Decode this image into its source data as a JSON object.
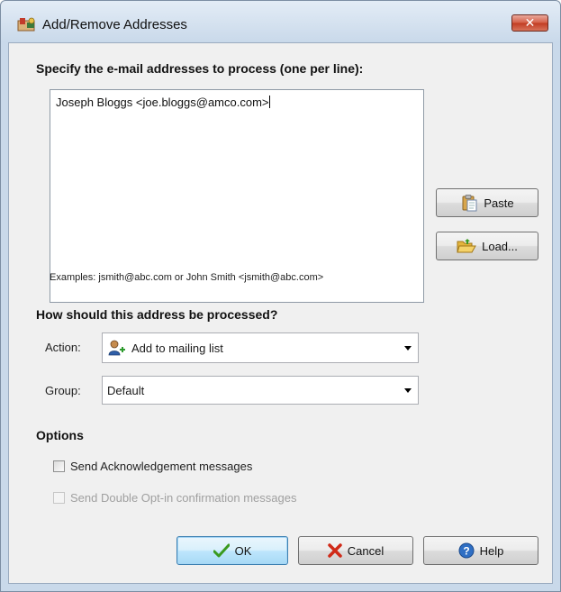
{
  "window": {
    "title": "Add/Remove Addresses",
    "close_glyph": "✕"
  },
  "addresses": {
    "heading": "Specify the e-mail addresses to process (one per line):",
    "value": "Joseph Bloggs <joe.bloggs@amco.com>",
    "examples": "Examples: jsmith@abc.com or John Smith <jsmith@abc.com>",
    "paste_label": "Paste",
    "load_label": "Load..."
  },
  "processing": {
    "heading": "How should this address be processed?",
    "action_label": "Action:",
    "action_value": "Add to mailing list",
    "action_icon": "add-user-icon",
    "group_label": "Group:",
    "group_value": "Default"
  },
  "options": {
    "heading": "Options",
    "acknowledgement_label": "Send Acknowledgement messages",
    "acknowledgement_checked": false,
    "double_optin_label": "Send Double Opt-in confirmation messages",
    "double_optin_checked": false,
    "double_optin_enabled": false
  },
  "footer": {
    "ok_label": "OK",
    "cancel_label": "Cancel",
    "help_label": "Help"
  },
  "colors": {
    "ok_check": "#3a9a1f",
    "cancel_x": "#d02a18",
    "help_blue": "#2f6fc4"
  }
}
